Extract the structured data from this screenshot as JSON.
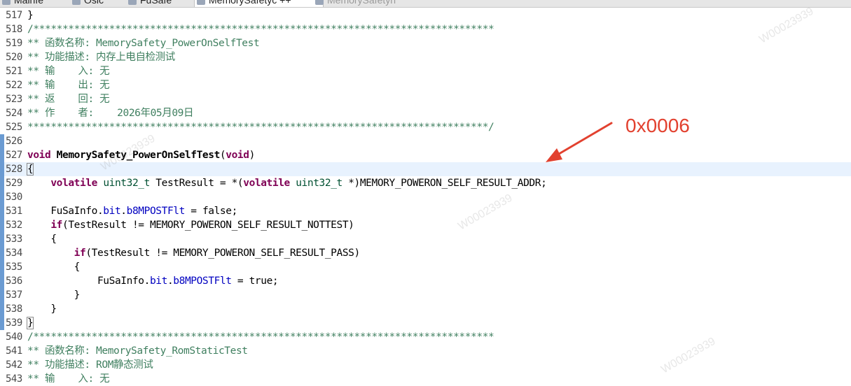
{
  "tabs": [
    {
      "label": "Mainfe",
      "active": false
    },
    {
      "label": "Osic",
      "active": false
    },
    {
      "label": "FuSafe",
      "active": false
    },
    {
      "label": "MemorySafetyc ++",
      "active": true
    },
    {
      "label": "MemorySafetyh",
      "active": false
    }
  ],
  "editor": {
    "current_line": "528",
    "lines": [
      {
        "num": "517",
        "tokens": [
          {
            "t": "}",
            "c": "plain"
          }
        ]
      },
      {
        "num": "518",
        "tokens": [
          {
            "t": "/*******************************************************************************",
            "c": "comment"
          }
        ]
      },
      {
        "num": "519",
        "tokens": [
          {
            "t": "** 函数名称: MemorySafety_PowerOnSelfTest",
            "c": "comment"
          }
        ]
      },
      {
        "num": "520",
        "tokens": [
          {
            "t": "** 功能描述: 内存上电自检测试",
            "c": "comment"
          }
        ]
      },
      {
        "num": "521",
        "tokens": [
          {
            "t": "** 输    入: 无",
            "c": "comment"
          }
        ]
      },
      {
        "num": "522",
        "tokens": [
          {
            "t": "** 输    出: 无",
            "c": "comment"
          }
        ]
      },
      {
        "num": "523",
        "tokens": [
          {
            "t": "** 返    回: 无",
            "c": "comment"
          }
        ]
      },
      {
        "num": "524",
        "tokens": [
          {
            "t": "** 作    者:    2026年05月09日",
            "c": "comment"
          }
        ]
      },
      {
        "num": "525",
        "tokens": [
          {
            "t": "*******************************************************************************/",
            "c": "comment"
          }
        ]
      },
      {
        "num": "526",
        "tokens": []
      },
      {
        "num": "527",
        "tokens": [
          {
            "t": "void",
            "c": "kw"
          },
          {
            "t": " ",
            "c": "plain"
          },
          {
            "t": "MemorySafety_PowerOnSelfTest",
            "c": "fn"
          },
          {
            "t": "(",
            "c": "plain"
          },
          {
            "t": "void",
            "c": "kw"
          },
          {
            "t": ")",
            "c": "plain"
          }
        ]
      },
      {
        "num": "528",
        "tokens": [
          {
            "t": "{",
            "c": "brace-hl"
          }
        ]
      },
      {
        "num": "529",
        "tokens": [
          {
            "t": "    ",
            "c": "plain"
          },
          {
            "t": "volatile",
            "c": "kw"
          },
          {
            "t": " ",
            "c": "plain"
          },
          {
            "t": "uint32_t",
            "c": "type"
          },
          {
            "t": " TestResult = *(",
            "c": "plain"
          },
          {
            "t": "volatile",
            "c": "kw"
          },
          {
            "t": " ",
            "c": "plain"
          },
          {
            "t": "uint32_t",
            "c": "type"
          },
          {
            "t": " *)MEMORY_POWERON_SELF_RESULT_ADDR;",
            "c": "plain"
          }
        ]
      },
      {
        "num": "530",
        "tokens": []
      },
      {
        "num": "531",
        "tokens": [
          {
            "t": "    FuSaInfo.",
            "c": "plain"
          },
          {
            "t": "bit",
            "c": "field"
          },
          {
            "t": ".",
            "c": "plain"
          },
          {
            "t": "b8MPOSTFlt",
            "c": "field"
          },
          {
            "t": " = false;",
            "c": "plain"
          }
        ]
      },
      {
        "num": "532",
        "tokens": [
          {
            "t": "    ",
            "c": "plain"
          },
          {
            "t": "if",
            "c": "kw"
          },
          {
            "t": "(TestResult != MEMORY_POWERON_SELF_RESULT_NOTTEST)",
            "c": "plain"
          }
        ]
      },
      {
        "num": "533",
        "tokens": [
          {
            "t": "    {",
            "c": "plain"
          }
        ]
      },
      {
        "num": "534",
        "tokens": [
          {
            "t": "        ",
            "c": "plain"
          },
          {
            "t": "if",
            "c": "kw"
          },
          {
            "t": "(TestResult != MEMORY_POWERON_SELF_RESULT_PASS)",
            "c": "plain"
          }
        ]
      },
      {
        "num": "535",
        "tokens": [
          {
            "t": "        {",
            "c": "plain"
          }
        ]
      },
      {
        "num": "536",
        "tokens": [
          {
            "t": "            FuSaInfo.",
            "c": "plain"
          },
          {
            "t": "bit",
            "c": "field"
          },
          {
            "t": ".",
            "c": "plain"
          },
          {
            "t": "b8MPOSTFlt",
            "c": "field"
          },
          {
            "t": " = true;",
            "c": "plain"
          }
        ]
      },
      {
        "num": "537",
        "tokens": [
          {
            "t": "        }",
            "c": "plain"
          }
        ]
      },
      {
        "num": "538",
        "tokens": [
          {
            "t": "    }",
            "c": "plain"
          }
        ]
      },
      {
        "num": "539",
        "tokens": [
          {
            "t": "}",
            "c": "brace-hl"
          }
        ]
      },
      {
        "num": "540",
        "tokens": [
          {
            "t": "/*******************************************************************************",
            "c": "comment"
          }
        ]
      },
      {
        "num": "541",
        "tokens": [
          {
            "t": "** 函数名称: MemorySafety_RomStaticTest",
            "c": "comment"
          }
        ]
      },
      {
        "num": "542",
        "tokens": [
          {
            "t": "** 功能描述: ROM静态测试",
            "c": "comment"
          }
        ]
      },
      {
        "num": "543",
        "tokens": [
          {
            "t": "** 输    入: 无",
            "c": "comment"
          }
        ]
      }
    ]
  },
  "annotation": {
    "text": "0x0006",
    "color": "#e2412f"
  },
  "watermark": {
    "text": "W00023939"
  },
  "colors": {
    "comment": "#3f7f5f",
    "keyword": "#7f0055",
    "type": "#005032",
    "field": "#0000c0",
    "current_line_bg": "#e8f2fe",
    "marker": "#6b9bd2"
  }
}
